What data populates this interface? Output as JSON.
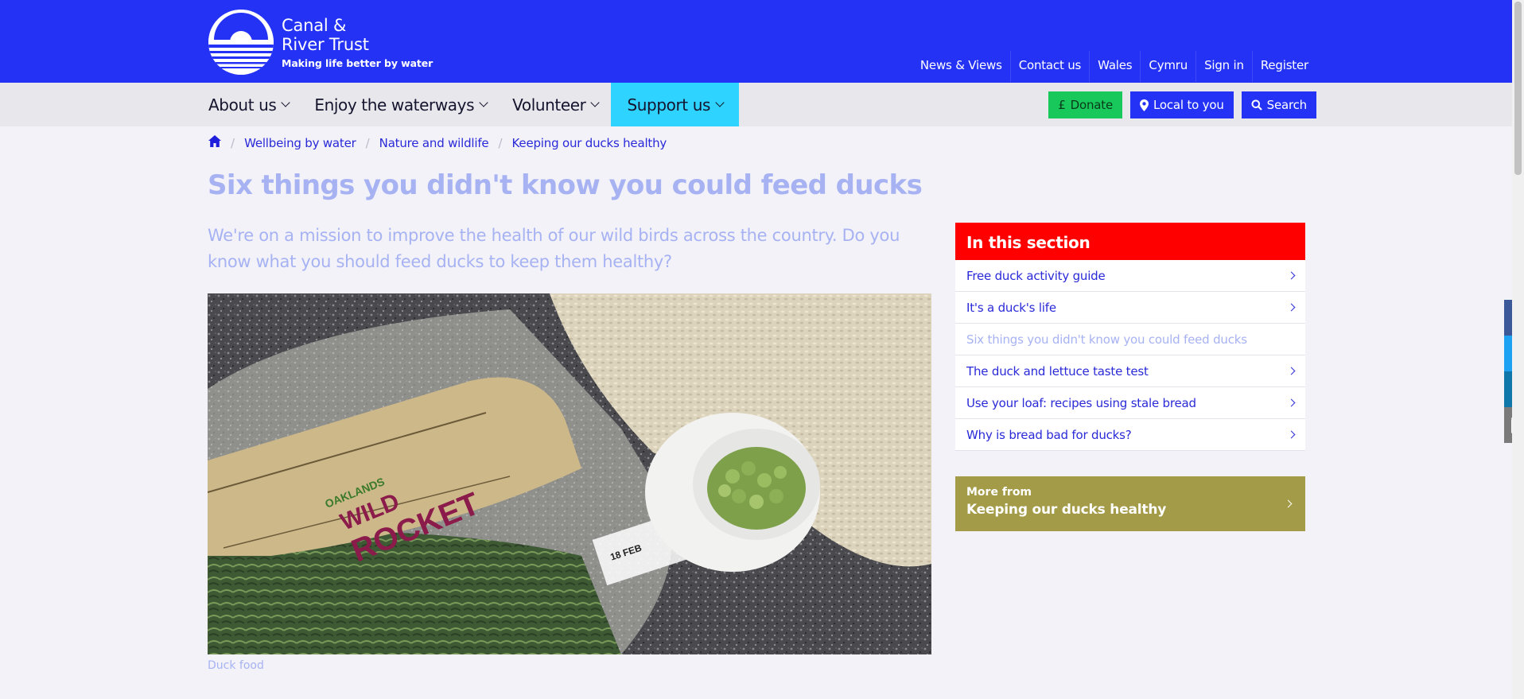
{
  "header": {
    "brand_line1": "Canal &",
    "brand_line2": "River Trust",
    "tagline": "Making life better by water",
    "utility_links": [
      "News & Views",
      "Contact us",
      "Wales",
      "Cymru",
      "Sign in",
      "Register"
    ]
  },
  "nav": {
    "items": [
      "About us",
      "Enjoy the waterways",
      "Volunteer",
      "Support us"
    ],
    "active": "Support us",
    "donate": "Donate",
    "local": "Local to you",
    "search": "Search"
  },
  "breadcrumb": [
    "Wellbeing by water",
    "Nature and wildlife",
    "Keeping our ducks healthy"
  ],
  "page": {
    "title": "Six things you didn't know you could feed ducks",
    "intro": "We're on a mission to improve the health of our wild birds across the country. Do you know what you should feed ducks to keep them healthy?",
    "caption": "Duck food",
    "photo_text": {
      "brand": "OAKLANDS",
      "product1": "WILD",
      "product2": "ROCKET",
      "date": "18 FEB"
    }
  },
  "sidebar": {
    "title": "In this section",
    "items": [
      "Free duck activity guide",
      "It's a duck's life",
      "Six things you didn't know you could feed ducks",
      "The duck and lettuce taste test",
      "Use your loaf: recipes using stale bread",
      "Why is bread bad for ducks?"
    ],
    "current_index": 2,
    "more_small": "More from",
    "more_big": "Keeping our ducks healthy"
  },
  "share": [
    "facebook-icon",
    "twitter-icon",
    "linkedin-icon",
    "email-icon"
  ],
  "colors": {
    "header": "#2332f4",
    "active_nav": "#2fd3ff",
    "donate": "#18c85a",
    "section_head": "#ff0000",
    "more_box": "#a39b47"
  }
}
